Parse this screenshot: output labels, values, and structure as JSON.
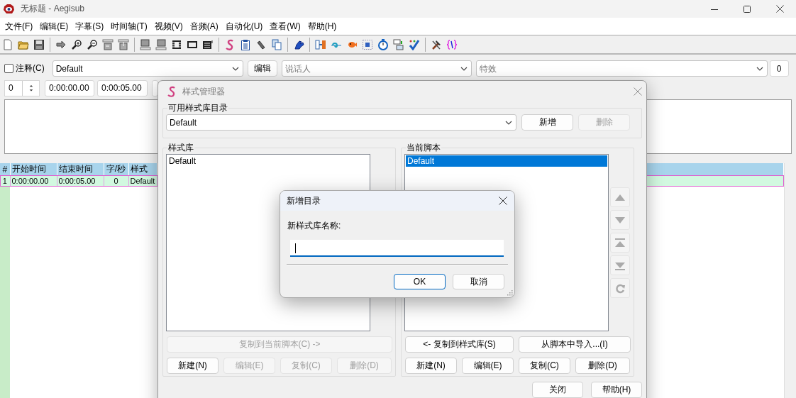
{
  "window": {
    "title": "无标题 - Aegisub"
  },
  "menu": [
    {
      "label": "文件(F)"
    },
    {
      "label": "编辑(E)"
    },
    {
      "label": "字幕(S)"
    },
    {
      "label": "时间轴(T)"
    },
    {
      "label": "视频(V)"
    },
    {
      "label": "音频(A)"
    },
    {
      "label": "自动化(U)"
    },
    {
      "label": "查看(W)"
    },
    {
      "label": "帮助(H)"
    }
  ],
  "edit_bar": {
    "comment": {
      "label": "注释(C)",
      "checked": false
    },
    "style": {
      "value": "Default"
    },
    "edit_button": "编辑",
    "actor": {
      "placeholder": "说话人"
    },
    "effect": {
      "placeholder": "特效"
    },
    "margin": {
      "value": "0"
    }
  },
  "time_bar": {
    "layer": "0",
    "start_time": "0:00:00.00",
    "end_time": "0:00:05.00"
  },
  "grid": {
    "columns": [
      "#",
      "开始时间",
      "结束时间",
      "字/秒",
      "样式"
    ],
    "rows": [
      {
        "cells": [
          "1",
          "0:00:00.00",
          "0:00:05.00",
          "0",
          "Default"
        ],
        "selected": true
      }
    ]
  },
  "style_manager": {
    "title": "样式管理器",
    "catalog": {
      "label": "可用样式库目录",
      "value": "Default",
      "buttons": [
        {
          "label": "新增",
          "disabled": false
        },
        {
          "label": "删除",
          "disabled": true
        }
      ]
    },
    "storage": {
      "label": "样式库",
      "items": [
        {
          "label": "Default",
          "selected": false
        }
      ],
      "copy_button": {
        "label": "复制到当前脚本(C) ->",
        "disabled": true
      },
      "buttons": [
        {
          "label": "新建(N)",
          "disabled": false
        },
        {
          "label": "编辑(E)",
          "disabled": true
        },
        {
          "label": "复制(C)",
          "disabled": true
        },
        {
          "label": "删除(D)",
          "disabled": true
        }
      ]
    },
    "current": {
      "label": "当前脚本",
      "items": [
        {
          "label": "Default",
          "selected": true
        }
      ],
      "copy_button": {
        "label": "<- 复制到样式库(S)",
        "disabled": false
      },
      "import_button": {
        "label": "从脚本中导入...(I)",
        "disabled": false
      },
      "buttons": [
        {
          "label": "新建(N)",
          "disabled": false
        },
        {
          "label": "编辑(E)",
          "disabled": false
        },
        {
          "label": "复制(C)",
          "disabled": false
        },
        {
          "label": "删除(D)",
          "disabled": false
        }
      ]
    },
    "footer_buttons": [
      {
        "label": "关闭"
      },
      {
        "label": "帮助(H)"
      }
    ]
  },
  "new_catalog_dialog": {
    "title": "新增目录",
    "label": "新样式库名称:",
    "input": {
      "focused": true
    },
    "buttons": [
      {
        "label": "OK",
        "default": true
      },
      {
        "label": "取消",
        "default": false
      }
    ]
  }
}
